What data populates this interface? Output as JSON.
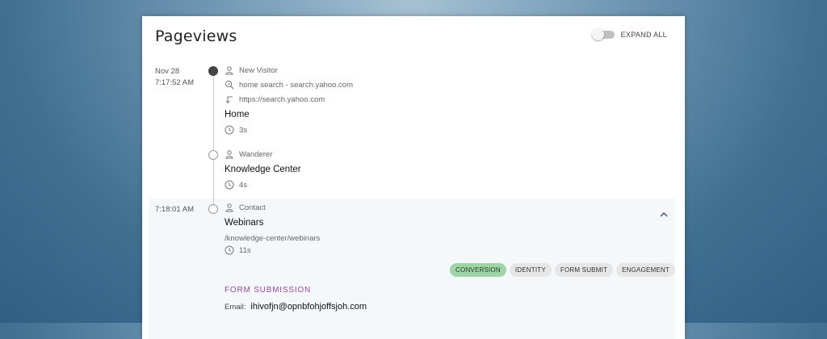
{
  "header": {
    "title": "Pageviews",
    "expand_all_label": "EXPAND ALL"
  },
  "entries": [
    {
      "date_line1": "Nov 28",
      "date_line2": "7:17:52 AM",
      "visitor_type": "New Visitor",
      "source": "home search - search.yahoo.com",
      "referrer": "https://search.yahoo.com",
      "page": "Home",
      "duration": "3s"
    },
    {
      "visitor_type": "Wanderer",
      "page": "Knowledge Center",
      "duration": "4s"
    },
    {
      "date_line1": "7:18:01 AM",
      "visitor_type": "Contact",
      "page": "Webinars",
      "url": "/knowledge-center/webinars",
      "duration": "11s",
      "tags": [
        "CONVERSION",
        "IDENTITY",
        "FORM SUBMIT",
        "ENGAGEMENT"
      ],
      "form": {
        "heading": "FORM SUBMISSION",
        "email_label": "Email:",
        "email_value": "ihivofjn@opnbfohjoffsjoh.com"
      }
    }
  ],
  "icons": {
    "person": "person-icon",
    "search": "search-source-icon",
    "referrer": "referrer-arrow-icon",
    "clock": "clock-icon",
    "chevron": "chevron-up-icon"
  },
  "colors": {
    "accent": "#9a47a8",
    "conversion_tag": "#9fd4a6",
    "chevron": "#4a6a9e",
    "expanded_bg": "#f4f8fb"
  }
}
